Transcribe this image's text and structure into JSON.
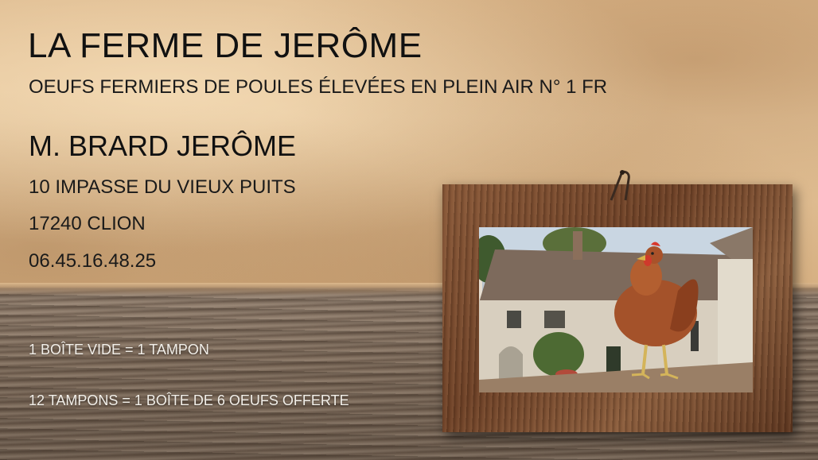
{
  "card": {
    "title": "LA FERME DE JERÔME",
    "subtitle": "OEUFS FERMIERS DE POULES ÉLEVÉES EN PLEIN AIR N° 1 FR",
    "owner": "M. BRARD JERÔME",
    "address_line": "10 IMPASSE DU VIEUX PUITS",
    "city_line": "17240 CLION",
    "phone": "06.45.16.48.25",
    "promo_1": "1 BOÎTE VIDE = 1 TAMPON",
    "promo_2": "12 TAMPONS = 1 BOÎTE DE 6 OEUFS OFFERTE"
  },
  "colors": {
    "parchment": "#dcb88c",
    "wood": "#7a6858",
    "frame": "#6e4228",
    "text_dark": "#111111",
    "text_light": "#f2efe9"
  },
  "icons": {
    "hook": "frame-hook-icon",
    "photo": "farmhouse-hen-photo"
  }
}
